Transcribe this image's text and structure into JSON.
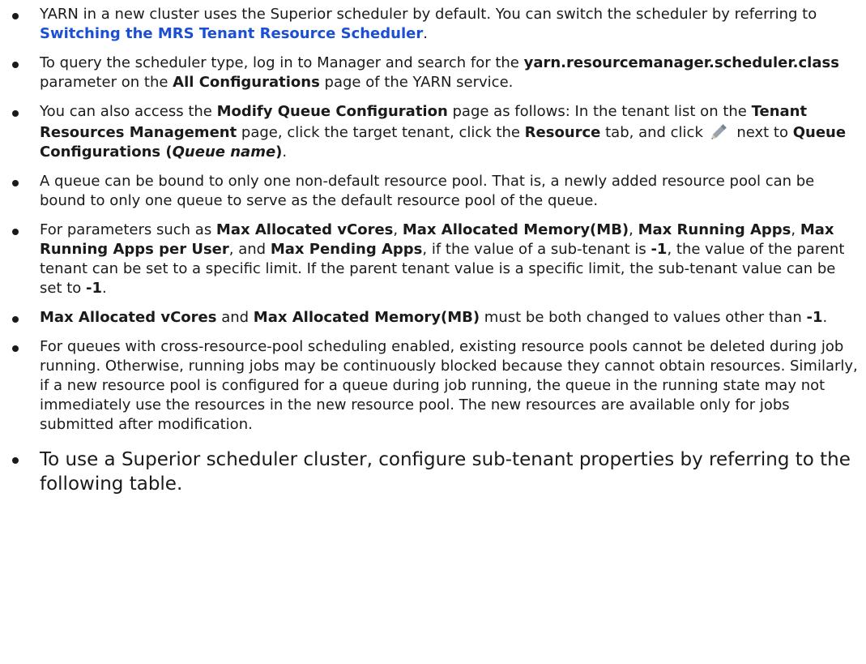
{
  "notes": [
    {
      "t0": "YARN in a new cluster uses the Superior scheduler by default. You can switch the scheduler by referring to ",
      "link": "Switching the MRS Tenant Resource Scheduler",
      "t1": "."
    },
    {
      "t0": "To query the scheduler type, log in to Manager and search for the ",
      "b0": "yarn.resourcemanager.scheduler.class",
      "t1": " parameter on the ",
      "b1": "All Configurations",
      "t2": " page of the YARN service."
    },
    {
      "t0": "You can also access the ",
      "b0": "Modify Queue Configuration",
      "t1": " page as follows: In the tenant list on the ",
      "b1": "Tenant Resources Management",
      "t2": " page, click the target tenant, click the ",
      "b2": "Resource",
      "t3": " tab, and click ",
      "icon": "pencil-edit-icon",
      "t4": " next to ",
      "b3": "Queue Configurations (",
      "bi": "Queue name",
      "b4": ")",
      "t5": "."
    },
    {
      "t0": "A queue can be bound to only one non-default resource pool. That is, a newly added resource pool can be bound to only one queue to serve as the default resource pool of the queue."
    },
    {
      "t0": "For parameters such as ",
      "b0": "Max Allocated vCores",
      "t1": ", ",
      "b1": "Max Allocated Memory(MB)",
      "t2": ", ",
      "b2": "Max Running Apps",
      "t3": ", ",
      "b3": "Max Running Apps per User",
      "t4": ", and ",
      "b4": "Max Pending Apps",
      "t5": ", if the value of a sub-tenant is ",
      "b5": "-1",
      "t6": ", the value of the parent tenant can be set to a specific limit. If the parent tenant value is a specific limit, the sub-tenant value can be set to ",
      "b6": "-1",
      "t7": "."
    },
    {
      "b0": "Max Allocated vCores",
      "t0": " and ",
      "b1": "Max Allocated Memory(MB)",
      "t1": " must be both changed to values other than ",
      "b2": "-1",
      "t2": "."
    },
    {
      "t0": "For queues with cross-resource-pool scheduling enabled, existing resource pools cannot be deleted during job running. Otherwise, running jobs may be continuously blocked because they cannot obtain resources. Similarly, if a new resource pool is configured for a queue during job running, the queue in the running state may not immediately use the resources in the new resource pool. The new resources are available only for jobs submitted after modification."
    },
    {
      "t0": "To use a Superior scheduler cluster, configure sub-tenant properties by referring to the following table."
    }
  ],
  "colors": {
    "text": "#1a1a1a",
    "link": "#1a4fd6"
  }
}
